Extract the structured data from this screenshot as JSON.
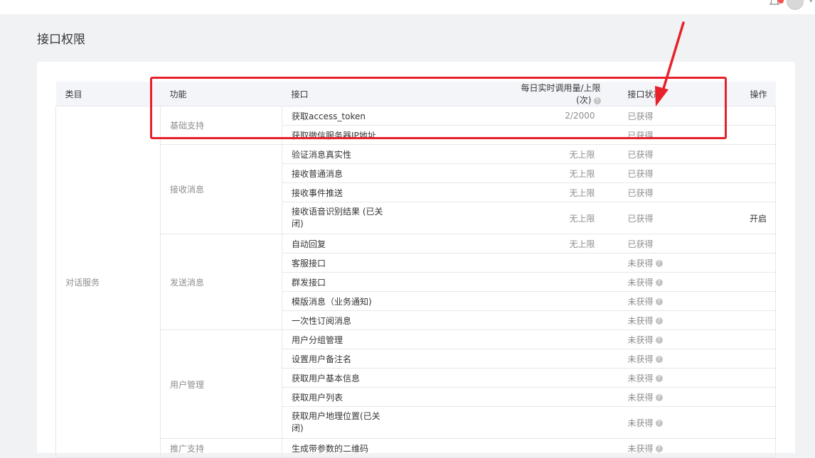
{
  "page": {
    "title": "接口权限"
  },
  "header": {
    "bell_icon": "bell-icon",
    "avatar_icon": "user-avatar",
    "notify_color": "#fa5151"
  },
  "table": {
    "columns": {
      "category": "类目",
      "feature": "功能",
      "api": "接口",
      "limit": "每日实时调用量/上限(次)",
      "status": "接口状态",
      "op": "操作"
    },
    "category": "对话服务",
    "groups": [
      {
        "name": "基础支持"
      },
      {
        "name": "接收消息"
      },
      {
        "name": "发送消息"
      },
      {
        "name": "用户管理"
      },
      {
        "name": "推广支持"
      }
    ],
    "rows": [
      {
        "api": "获取access_token",
        "limit": "2/2000",
        "status": "已获得",
        "op": ""
      },
      {
        "api": "获取微信服务器IP地址",
        "limit": "",
        "status": "已获得",
        "op": ""
      },
      {
        "api": "验证消息真实性",
        "limit": "无上限",
        "status": "已获得",
        "op": ""
      },
      {
        "api": "接收普通消息",
        "limit": "无上限",
        "status": "已获得",
        "op": ""
      },
      {
        "api": "接收事件推送",
        "limit": "无上限",
        "status": "已获得",
        "op": ""
      },
      {
        "api": "接收语音识别结果 (已关闭)",
        "limit": "无上限",
        "status": "已获得",
        "op": "开启"
      },
      {
        "api": "自动回复",
        "limit": "无上限",
        "status": "已获得",
        "op": ""
      },
      {
        "api": "客服接口",
        "limit": "",
        "status": "未获得",
        "op": ""
      },
      {
        "api": "群发接口",
        "limit": "",
        "status": "未获得",
        "op": ""
      },
      {
        "api": "模版消息（业务通知)",
        "limit": "",
        "status": "未获得",
        "op": ""
      },
      {
        "api": "一次性订阅消息",
        "limit": "",
        "status": "未获得",
        "op": ""
      },
      {
        "api": "用户分组管理",
        "limit": "",
        "status": "未获得",
        "op": ""
      },
      {
        "api": "设置用户备注名",
        "limit": "",
        "status": "未获得",
        "op": ""
      },
      {
        "api": "获取用户基本信息",
        "limit": "",
        "status": "未获得",
        "op": ""
      },
      {
        "api": "获取用户列表",
        "limit": "",
        "status": "未获得",
        "op": ""
      },
      {
        "api": "获取用户地理位置(已关闭)",
        "limit": "",
        "status": "未获得",
        "op": ""
      },
      {
        "api": "生成带参数的二维码",
        "limit": "",
        "status": "未获得",
        "op": ""
      }
    ],
    "help_icon": "?"
  },
  "annotation": {
    "highlight_color": "#e8202a"
  }
}
